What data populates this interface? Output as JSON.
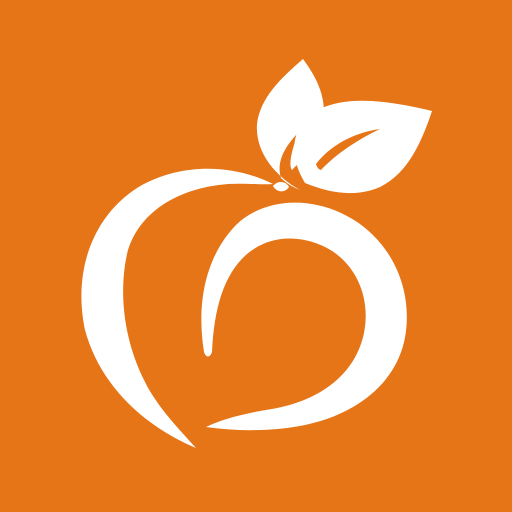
{
  "icon": {
    "name": "peach-icon",
    "colors": {
      "background": "#E67517",
      "foreground": "#FFFFFF"
    }
  }
}
